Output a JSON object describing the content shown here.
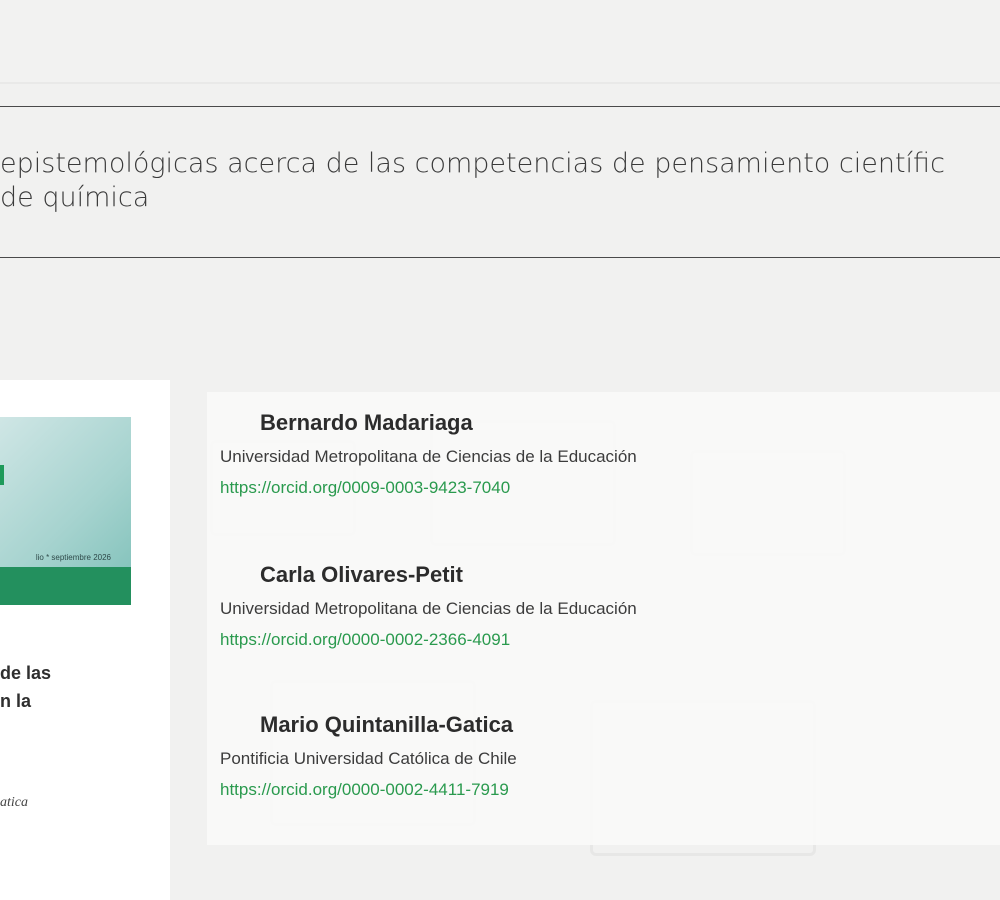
{
  "article": {
    "title_line1": "epistemológicas acerca de las competencias de pensamiento científic",
    "title_line2": " de química"
  },
  "cover": {
    "issue_text": "lio * septiembre 2026",
    "title_line1": "de las",
    "title_line2": "n la",
    "author_fragment": "atica",
    "accent_color": "#23905e"
  },
  "authors": [
    {
      "name": "Bernardo Madariaga",
      "affiliation": "Universidad Metropolitana de Ciencias de la Educación",
      "orcid": "https://orcid.org/0009-0003-9423-7040"
    },
    {
      "name": "Carla Olivares-Petit",
      "affiliation": "Universidad Metropolitana de Ciencias de la Educación",
      "orcid": "https://orcid.org/0000-0002-2366-4091"
    },
    {
      "name": "Mario Quintanilla-Gatica",
      "affiliation": "Pontificia Universidad Católica de Chile",
      "orcid": "https://orcid.org/0000-0002-4411-7919"
    }
  ],
  "colors": {
    "link": "#2a9a4e",
    "background": "#f1f1f0",
    "rule": "#4a4a4a"
  }
}
